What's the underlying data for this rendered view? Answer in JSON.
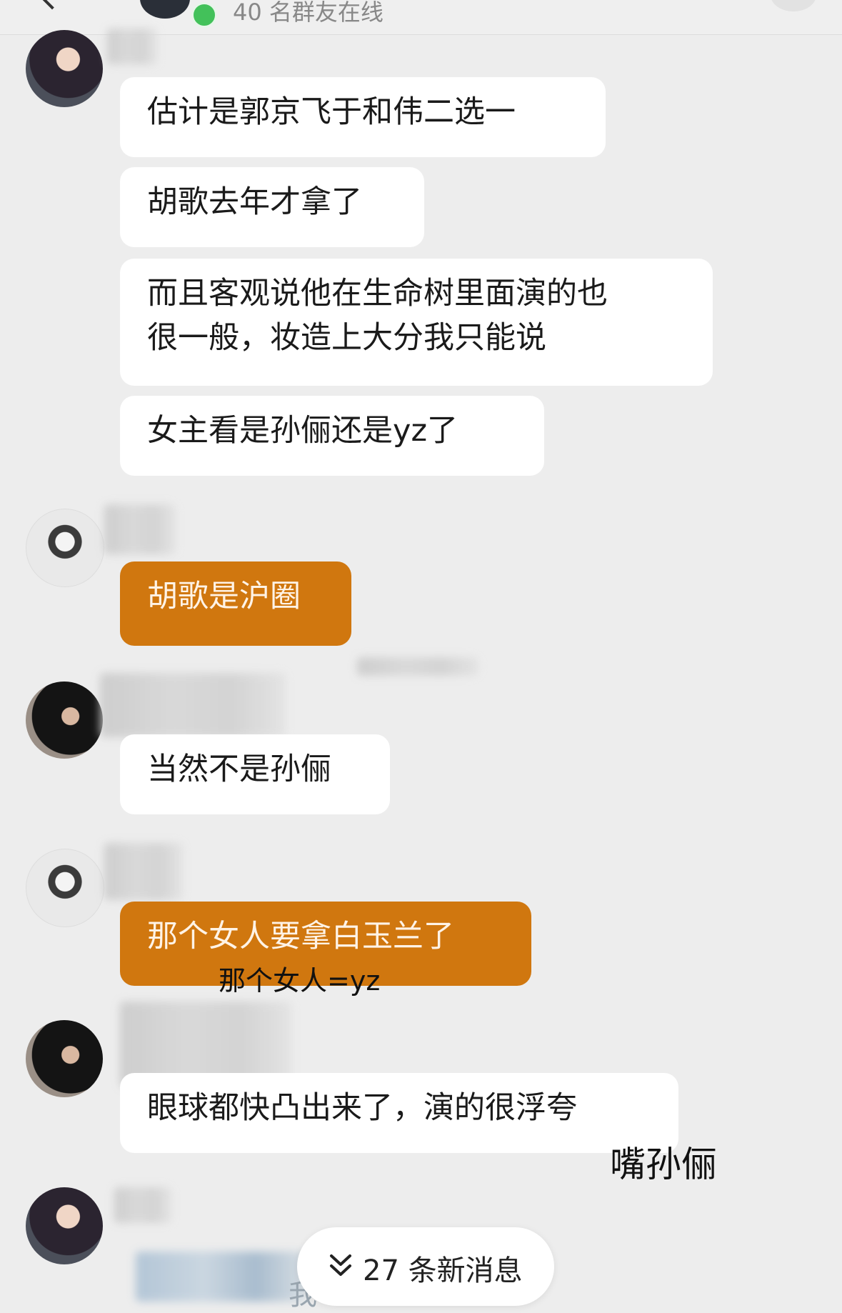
{
  "header": {
    "online_status": "40 名群友在线"
  },
  "messages": [
    {
      "bubble": "估计是郭京飞于和伟二选一"
    },
    {
      "bubble": "胡歌去年才拿了"
    },
    {
      "bubble_line1": "而且客观说他在生命树里面演的也",
      "bubble_line2": "很一般，妆造上大分我只能说"
    },
    {
      "bubble": "女主看是孙俪还是yz了"
    },
    {
      "bubble": "胡歌是沪圈"
    },
    {
      "bubble": "当然不是孙俪"
    },
    {
      "bubble": "那个女人要拿白玉兰了"
    },
    {
      "bubble": "眼球都快凸出来了，演的很浮夸"
    }
  ],
  "annotations": {
    "note1": "那个女人=yz",
    "note2": "嘴孙俪"
  },
  "new_messages_pill": {
    "label": "27 条新消息",
    "icon": "double-chevron-down-icon"
  },
  "colors": {
    "background": "#ededed",
    "bubble_white": "#ffffff",
    "bubble_orange": "#d0770f",
    "online_green": "#43c15a"
  },
  "bottom_partial_text": "我"
}
